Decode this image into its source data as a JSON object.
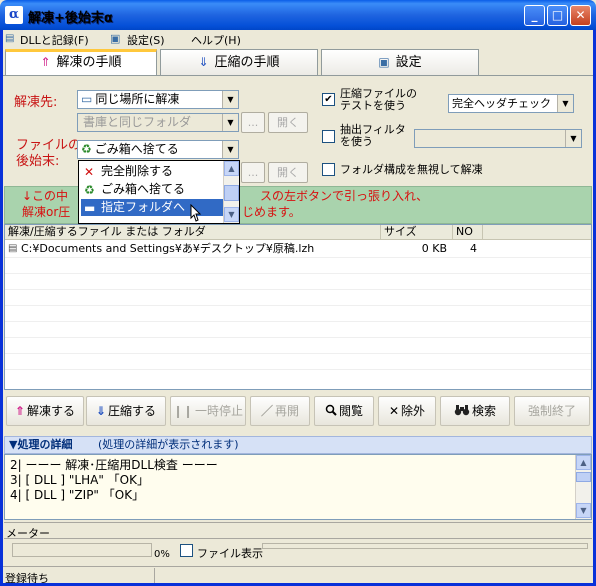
{
  "window": {
    "title": "解凍+後始末α",
    "app_icon": "α",
    "minimize_icon": "_",
    "maximize_icon": "□",
    "close_icon": "✕"
  },
  "menu": {
    "items": [
      "DLLと記録(F)",
      "設定(S)",
      "ヘルプ(H)"
    ]
  },
  "tabs": [
    {
      "label": "解凍の手順",
      "icon": "pin-icon",
      "glyph": "⇑",
      "color": "#D0208A"
    },
    {
      "label": "圧縮の手順",
      "icon": "download-icon",
      "glyph": "⇓",
      "color": "#2050C0"
    },
    {
      "label": "設定",
      "icon": "settings-icon",
      "glyph": "▣",
      "color": "#3A6EA5"
    }
  ],
  "form": {
    "dest_label": "解凍先:",
    "dest_value": "同じ場所に解凍",
    "dest_sub_value": "書庫と同じフォルダ",
    "browse_btn": "...",
    "open_btn": "開く",
    "file_label_1": "ファイルの",
    "file_label_2": "後始末:",
    "file_value": "ごみ箱へ捨てる",
    "test_chk_label_1": "圧縮ファイルの",
    "test_chk_label_2": "テストを使う",
    "test_chk_checked": "✔",
    "test_select": "完全ヘッダチェック",
    "filter_chk_label_1": "抽出フィルタ",
    "filter_chk_label_2": "を使う",
    "ignore_folder_label": "フォルダ構成を無視して解凍"
  },
  "dropdown": {
    "items": [
      {
        "label": "完全削除する",
        "icon": "delete-icon",
        "glyph": "✕",
        "color": "#D01010"
      },
      {
        "label": "ごみ箱へ捨てる",
        "icon": "recycle-bin-icon",
        "glyph": "♻",
        "color": "#2A8A2A"
      },
      {
        "label": "指定フォルダへ",
        "icon": "folder-icon",
        "glyph": "▬",
        "color": "#5A7AA0"
      }
    ],
    "selected_index": 2
  },
  "info": {
    "line1_left": "↓この中",
    "line1_right": "スの左ボタンで引っ張り入れ、",
    "line2_left": "解凍or圧",
    "line2_right": "じめます。"
  },
  "list": {
    "columns": [
      "解凍/圧縮するファイル または フォルダ",
      "サイズ",
      "NO"
    ],
    "rows": [
      {
        "name": "C:¥Documents and Settings¥あ¥デスクトップ¥原稿.lzh",
        "size": "0 KB",
        "no": "4"
      }
    ]
  },
  "actions": [
    {
      "label": "解凍する",
      "icon": "extract-icon",
      "glyph": "⇑",
      "color": "#D0208A",
      "enabled": true
    },
    {
      "label": "圧縮する",
      "icon": "compress-icon",
      "glyph": "⇓",
      "color": "#2050C0",
      "enabled": true
    },
    {
      "label": "一時停止",
      "icon": "pause-icon",
      "glyph": "❙❙",
      "color": "#A7A69F",
      "enabled": false
    },
    {
      "label": "再開",
      "icon": "resume-icon",
      "glyph": "／",
      "color": "#A7A69F",
      "enabled": false
    },
    {
      "label": "閲覧",
      "icon": "magnifier-icon",
      "glyph": "🔍",
      "color": "#000",
      "enabled": true
    },
    {
      "label": "除外",
      "icon": "exclude-icon",
      "glyph": "✕",
      "color": "#000",
      "enabled": true
    },
    {
      "label": "検索",
      "icon": "binoculars-icon",
      "glyph": "♠",
      "color": "#000",
      "enabled": true
    },
    {
      "label": "強制終了",
      "icon": "force-stop-icon",
      "glyph": "",
      "color": "#A7A69F",
      "enabled": false
    }
  ],
  "detail": {
    "header": "▼処理の詳細",
    "header_note": "(処理の詳細が表示されます)",
    "lines": [
      "2| ーーー 解凍･圧縮用DLL検査 ーーー",
      "3| [ DLL ] \"LHA\"   「OK」",
      "4| [ DLL ] \"ZIP\"   「OK」"
    ]
  },
  "meter": {
    "label": "メーター",
    "percent": "0%",
    "file_display_label": "ファイル表示"
  },
  "status": {
    "text": "登録待ち"
  }
}
